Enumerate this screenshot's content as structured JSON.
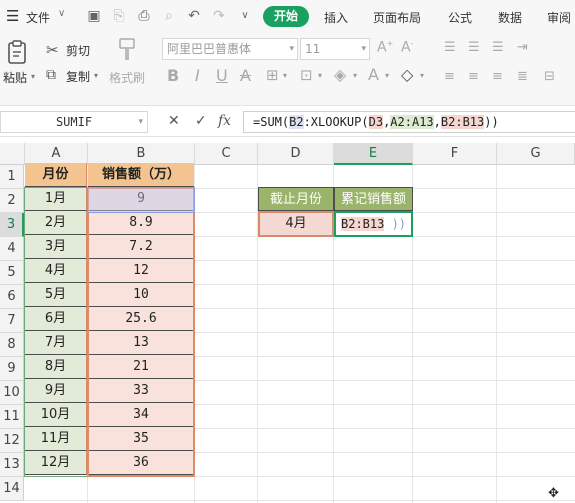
{
  "menubar": {
    "file_label": "文件",
    "tabs": [
      "开始",
      "插入",
      "页面布局",
      "公式",
      "数据",
      "审阅"
    ]
  },
  "ribbon": {
    "paste_label": "粘贴",
    "cut_label": "剪切",
    "copy_label": "复制",
    "format_painter_label": "格式刷",
    "font_name": "阿里巴巴普惠体",
    "font_size": "11"
  },
  "formula_bar": {
    "name_box": "SUMIF",
    "fx_label": "fx",
    "formula_parts": [
      "=SUM(",
      "B2",
      ":XLOOKUP(",
      "D3",
      ",",
      "A2:A13",
      ",",
      "B2:B13",
      "))"
    ]
  },
  "sheet": {
    "columns": [
      "A",
      "B",
      "C",
      "D",
      "E",
      "F",
      "G"
    ],
    "rows": [
      "1",
      "2",
      "3",
      "4",
      "5",
      "6",
      "7",
      "8",
      "9",
      "10",
      "11",
      "12",
      "13",
      "14"
    ],
    "header_a": "月份",
    "header_b": "销售额（万）",
    "months": [
      "1月",
      "2月",
      "3月",
      "4月",
      "5月",
      "6月",
      "7月",
      "8月",
      "9月",
      "10月",
      "11月",
      "12月"
    ],
    "sales": [
      "9",
      "8.9",
      "7.2",
      "12",
      "10",
      "25.6",
      "13",
      "21",
      "33",
      "34",
      "35",
      "36"
    ],
    "d2": "截止月份",
    "e2": "累记销售额",
    "d3": "4月",
    "e3_ref": "B2:B13",
    "e3_tail": " ))"
  },
  "colors": {
    "accent": "#1aa15f",
    "header_fill": "#f3c490",
    "month_fill": "#e2ead8",
    "sales_fill": "#f9e2dc",
    "lookup_header_fill": "#9bb46b"
  }
}
